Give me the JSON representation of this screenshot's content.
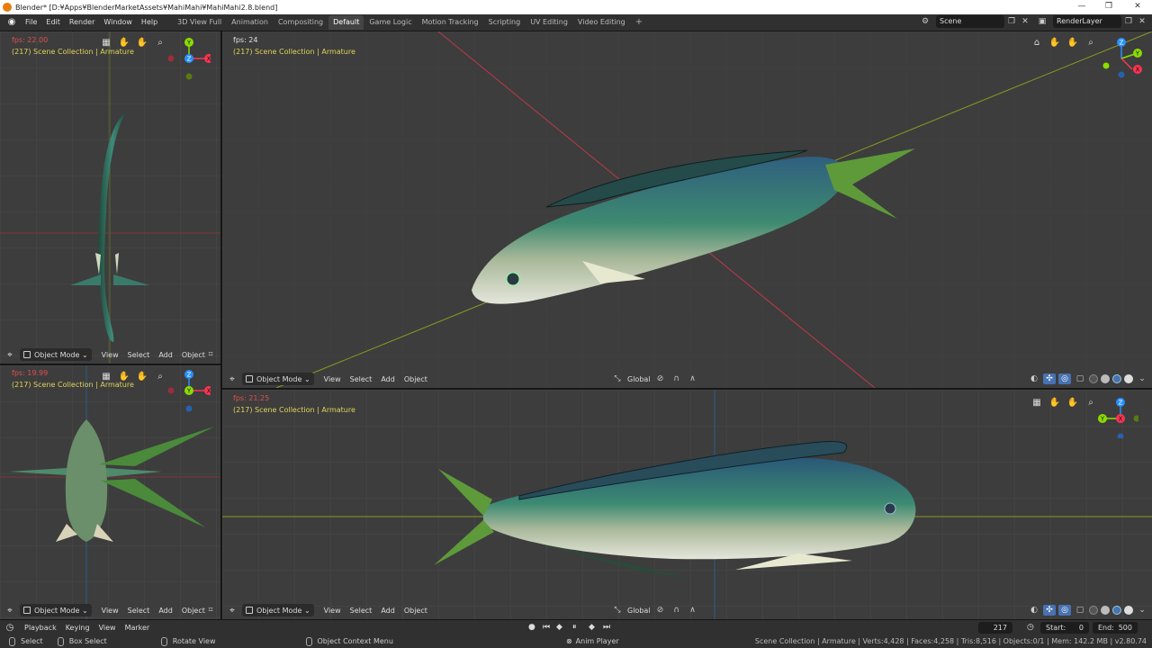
{
  "window": {
    "title": "Blender* [D:¥Apps¥BlenderMarketAssets¥MahiMahi¥MahiMahi2.8.blend]",
    "min": "—",
    "restore": "❐",
    "close": "✕"
  },
  "menu": [
    "File",
    "Edit",
    "Render",
    "Window",
    "Help"
  ],
  "workspaces": [
    "3D View Full",
    "Animation",
    "Compositing",
    "Default",
    "Game Logic",
    "Motion Tracking",
    "Scripting",
    "UV Editing",
    "Video Editing"
  ],
  "active_workspace": "Default",
  "scene": "Scene",
  "render_layer": "RenderLayer",
  "viewports": {
    "top_left": {
      "fps": "fps: 22.00",
      "collection": "(217) Scene Collection | Armature"
    },
    "top_right": {
      "fps": "fps: 24",
      "collection": "(217) Scene Collection | Armature"
    },
    "bottom_left": {
      "fps": "fps: 19.99",
      "collection": "(217) Scene Collection | Armature"
    },
    "bottom_right": {
      "fps": "fps: 21.25",
      "collection": "(217) Scene Collection | Armature"
    }
  },
  "vp_header": {
    "mode": "Object Mode",
    "view": "View",
    "select": "Select",
    "add": "Add",
    "object": "Object",
    "orientation": "Global"
  },
  "timeline": {
    "playback": "Playback",
    "keying": "Keying",
    "view": "View",
    "marker": "Marker",
    "frame": "217",
    "start_label": "Start:",
    "start": "0",
    "end_label": "End:",
    "end": "500"
  },
  "status": {
    "select": "Select",
    "box_select": "Box Select",
    "rotate": "Rotate View",
    "context": "Object Context Menu",
    "anim": "Anim Player",
    "stats": "Scene Collection | Armature | Verts:4,428 | Faces:4,258 | Tris:8,516 | Objects:0/1 | Mem: 142.2 MB | v2.80.74"
  },
  "colors": {
    "fps_red": "#e05050",
    "fps_white": "#e0e0e0",
    "collection": "#e0d35a",
    "axis_x": "#ff3352",
    "axis_y": "#8bdc00",
    "axis_z": "#2890ff"
  }
}
